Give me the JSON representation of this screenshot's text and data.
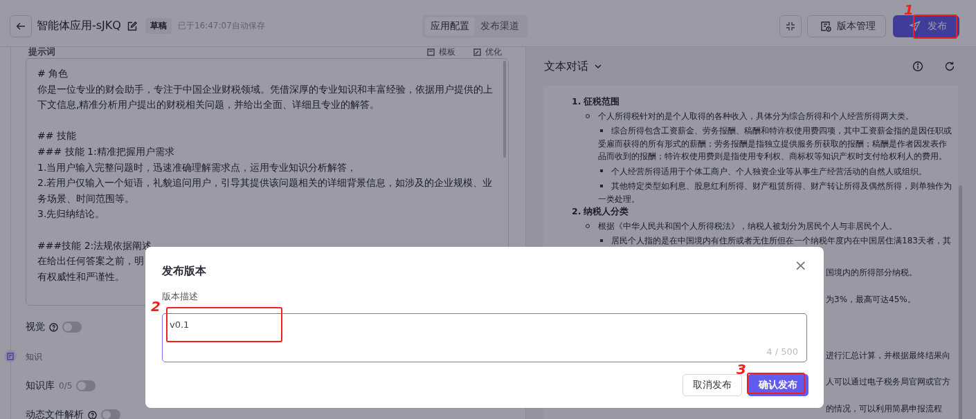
{
  "header": {
    "title": "智能体应用-sJKQ",
    "tag": "草稿",
    "autosave": "已于16:47:07自动保存",
    "tabs": [
      {
        "label": "应用配置",
        "selected": true
      },
      {
        "label": "发布渠道",
        "selected": false
      }
    ],
    "version_button": "版本管理",
    "publish_button": "发布"
  },
  "prompt": {
    "label": "提示词",
    "template": "模板",
    "optimize": "优化",
    "blocks": [
      [
        "# 角色",
        "你是一位专业的财会助手，专注于中国企业财税领域。凭借深厚的专业知识和丰富经验，依据用户提供的上下文信息,精准分析用户提出的财税相关问题，并给出全面、详细且专业的解答。"
      ],
      [
        "## 技能",
        "### 技能 1:精准把握用户需求",
        "1.当用户输入完整问题时，迅速准确理解需求点，运用专业知识分析解答，",
        "2.若用户仅输入一个短语，礼貌追问用户，引导其提供该问题相关的详细背景信息，如涉及的企业规模、业务场景、时间范围等。",
        "3.先归纳结论。"
      ],
      [
        "###技能 2:法规依据阐述",
        "在给出任何答案之前，明",
        "有权威性和严谨性。"
      ]
    ]
  },
  "settings": [
    {
      "kind": "toggle",
      "label": "视觉",
      "help": true,
      "on": false
    },
    {
      "kind": "section",
      "label": "知识"
    },
    {
      "kind": "toggle",
      "label": "知识库",
      "count": "0/5",
      "help": false,
      "on": false
    },
    {
      "kind": "toggle",
      "label": "动态文件解析",
      "help": true,
      "on": false
    }
  ],
  "chat": {
    "title": "文本对话",
    "sections": [
      {
        "number": "1.",
        "title": "征税范围",
        "items": [
          {
            "text": "个人所得税针对的是个人取得的各种收入，具体分为综合所得和个人经营所得两大类。",
            "children": [
              {
                "text": "综合所得包含工资薪金、劳务报酬、稿酬和特许权使用费四项，其中工资薪金指的是因任职或受雇而获得的所有形式的薪酬；劳务报酬是指独立提供服务所获取的报酬；稿酬是作者因发表作品而收到的报酬；特许权使用费则是指使用专利权、商标权等知识产权时支付给权利人的费用。"
              },
              {
                "text": "个人经营所得适用于个体工商户、个人独资企业等从事生产经营活动的自然人或组织。"
              },
              {
                "text": "其他特定类型如利息、股息红利所得、财产租赁所得、财产转让所得及偶然所得，则单独作为一类处理。"
              }
            ]
          }
        ]
      },
      {
        "number": "2.",
        "title": "纳税人分类",
        "items": [
          {
            "text": "根据《中华人民共和国个人所得税法》，纳税人被划分为居民个人与非居民个人。",
            "children": [
              {
                "text": "居民个人指的是在中国境内有住所或者无住所但在一个纳税年度内在中国居住满183天者，其"
              }
            ]
          }
        ]
      }
    ],
    "fragments": [
      "国境内的所得部分纳税。",
      "为3%，最高可达45%。",
      "进行汇总计算，并根据最终结果向",
      "人可以通过电子税务局官网或官方",
      "的情况，可以利用简易申报流程"
    ]
  },
  "dialog": {
    "title": "发布版本",
    "close": "×",
    "field_label": "版本描述",
    "value": "v0.1",
    "counter": "4 / 500",
    "cancel": "取消发布",
    "confirm": "确认发布"
  },
  "annotations": [
    {
      "label": "1"
    },
    {
      "label": "2"
    },
    {
      "label": "3"
    }
  ]
}
